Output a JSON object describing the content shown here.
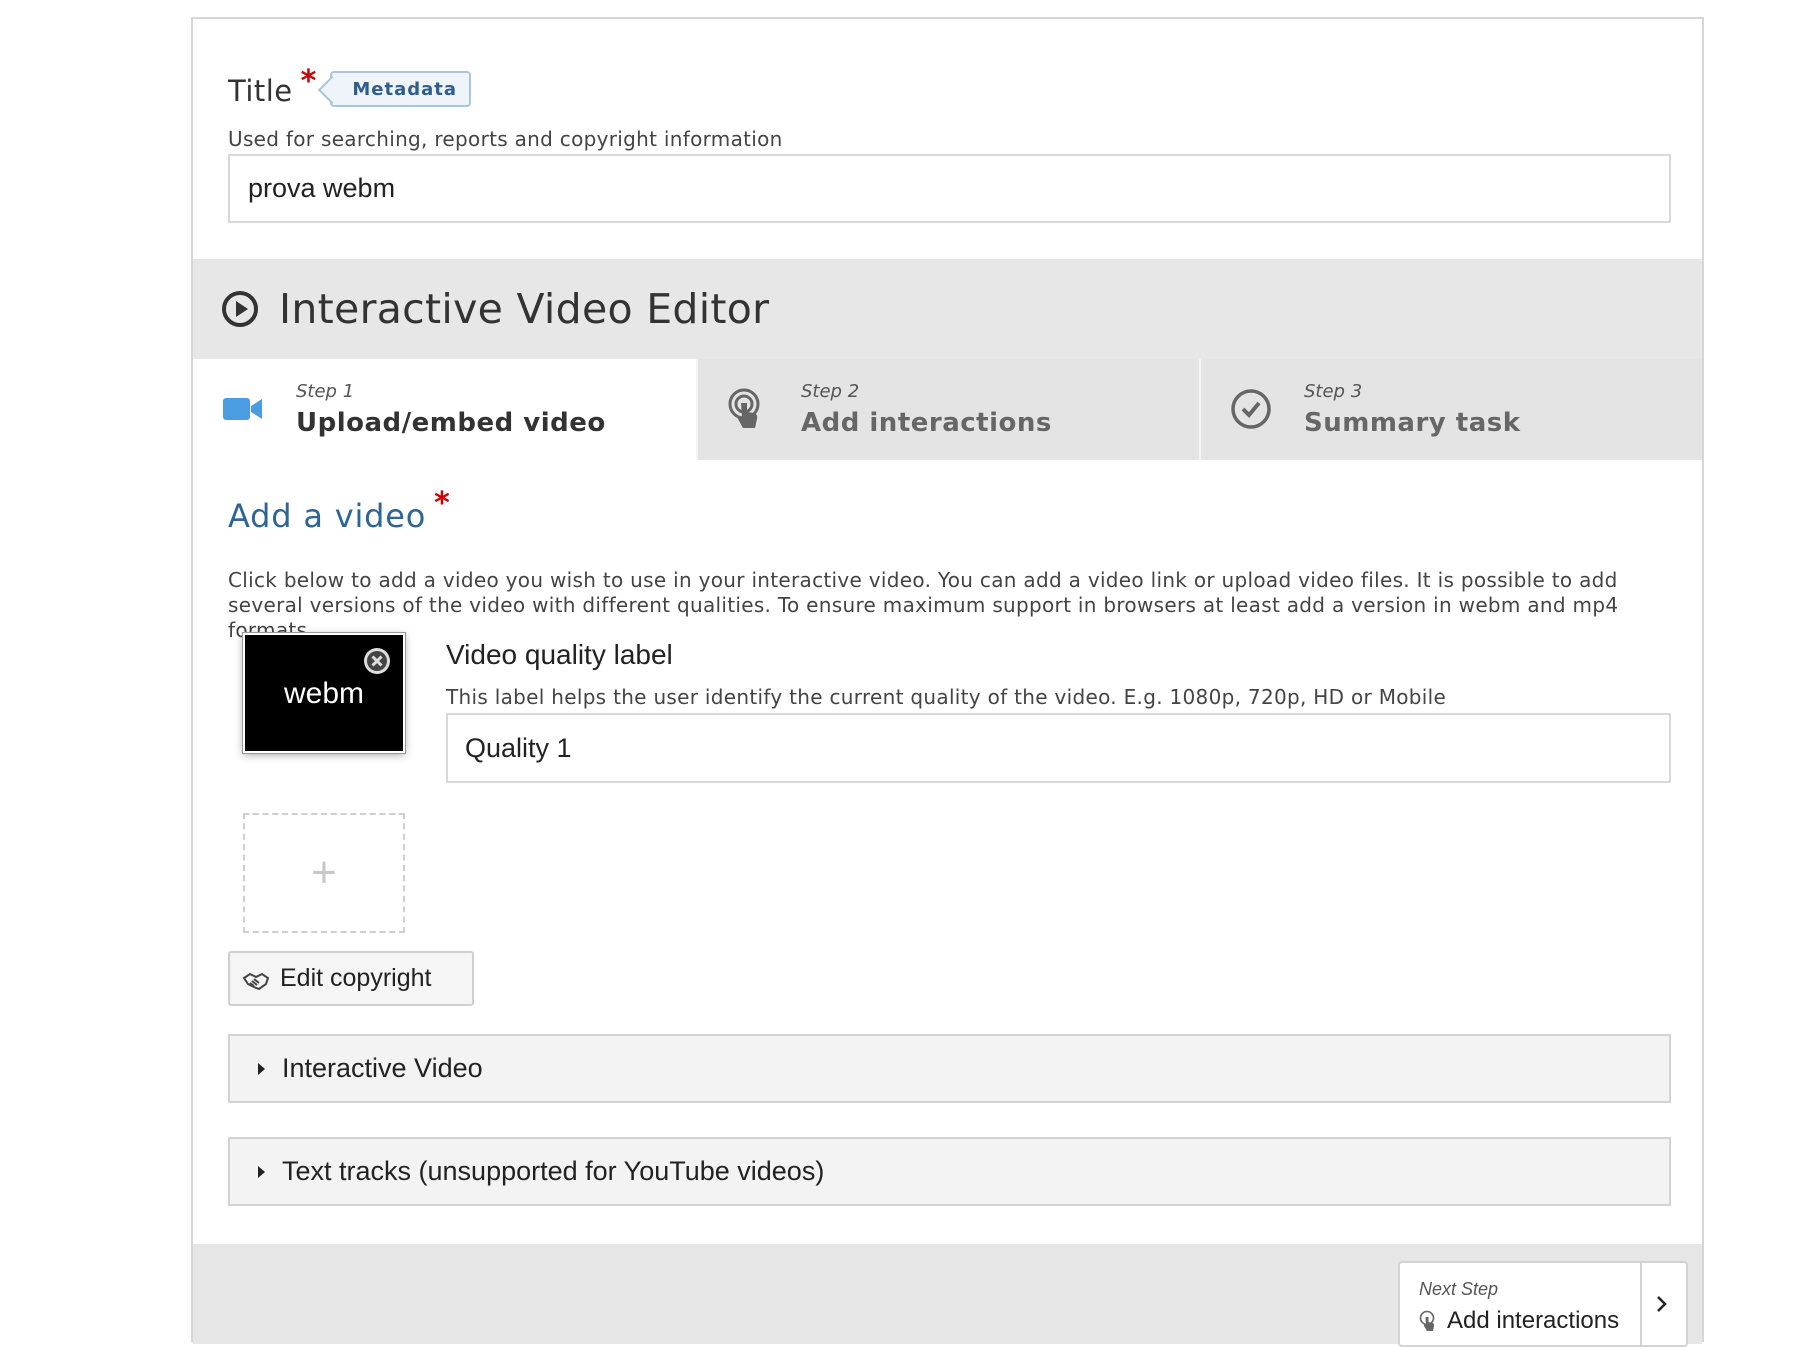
{
  "title_field": {
    "label": "Title",
    "required_mark": "*",
    "metadata_label": "Metadata",
    "description": "Used for searching, reports and copyright information",
    "value": "prova webm"
  },
  "editor": {
    "title": "Interactive Video Editor",
    "steps": [
      {
        "number": "Step 1",
        "name": "Upload/embed video",
        "icon": "video-camera-icon",
        "active": true
      },
      {
        "number": "Step 2",
        "name": "Add interactions",
        "icon": "touch-pointer-icon",
        "active": false
      },
      {
        "number": "Step 3",
        "name": "Summary task",
        "icon": "check-circle-icon",
        "active": false
      }
    ]
  },
  "add_video": {
    "title": "Add a video",
    "required_mark": "*",
    "description": "Click below to add a video you wish to use in your interactive video. You can add a video link or upload video files. It is possible to add several versions of the video with different qualities. To ensure maximum support in browsers at least add a version in webm and mp4 formats.",
    "file_label": "webm",
    "add_slot_symbol": "+",
    "quality_label": "Video quality label",
    "quality_description": "This label helps the user identify the current quality of the video. E.g. 1080p, 720p, HD or Mobile",
    "quality_value": "Quality 1",
    "copyright_button": "Edit copyright"
  },
  "groups": [
    {
      "label": "Interactive Video"
    },
    {
      "label": "Text tracks (unsupported for YouTube videos)"
    }
  ],
  "footer": {
    "next_small": "Next Step",
    "next_label": "Add interactions"
  },
  "colors": {
    "accent_blue": "#2e6596",
    "step_icon_blue": "#4a9de0",
    "required_red": "#cc0000",
    "header_gray": "#e7e7e7"
  }
}
